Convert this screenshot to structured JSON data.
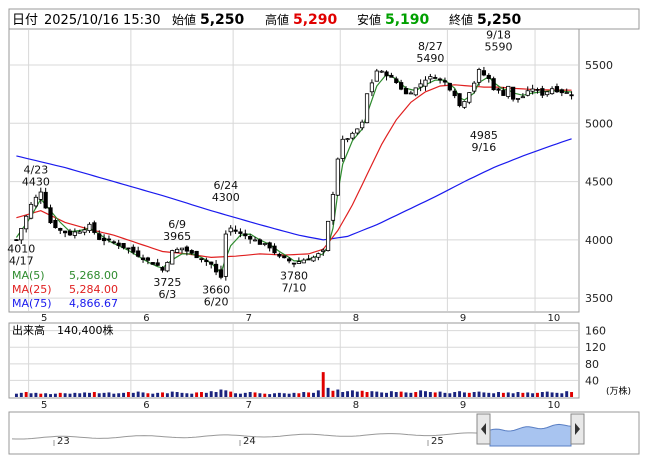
{
  "header": {
    "date_label": "日付",
    "date_value": "2025/10/16 15:30",
    "open_label": "始値",
    "open_value": "5,250",
    "high_label": "高値",
    "high_value": "5,290",
    "low_label": "安値",
    "low_value": "5,190",
    "close_label": "終値",
    "close_value": "5,250"
  },
  "colors": {
    "bull": "#ffffff",
    "bear": "#000000",
    "ma5": "#2e8b2e",
    "ma25": "#e02020",
    "ma75": "#1a1aee",
    "high_text": "#e00000",
    "low_text": "#00a000",
    "volume_bar": "#1a237e",
    "volume_highlight": "#e00000",
    "overview_fill": "#a8c4f0"
  },
  "chart_data": [
    {
      "type": "candlestick",
      "y_ticks": [
        3500,
        4000,
        4500,
        5000,
        5500
      ],
      "ylim": [
        3390,
        5800
      ],
      "x_ticks": [
        "5",
        "6",
        "7",
        "8",
        "9",
        "10"
      ],
      "legend": [
        {
          "name": "MA(5)",
          "value": "5,268.00"
        },
        {
          "name": "MA(25)",
          "value": "5,284.00"
        },
        {
          "name": "MA(75)",
          "value": "4,866.67"
        }
      ],
      "annotations": [
        {
          "label": "4/23",
          "value": "4430"
        },
        {
          "label": "4/17",
          "value": "4010"
        },
        {
          "label": "6/9",
          "value": "3965"
        },
        {
          "label": "6/3",
          "value": "3725"
        },
        {
          "label": "6/24",
          "value": "4300"
        },
        {
          "label": "6/20",
          "value": "3660"
        },
        {
          "label": "7/10",
          "value": "3780"
        },
        {
          "label": "8/27",
          "value": "5490"
        },
        {
          "label": "9/18",
          "value": "5590"
        },
        {
          "label": "9/16",
          "value": "4985"
        }
      ],
      "close_path": [
        [
          0,
          4000
        ],
        [
          3,
          4300
        ],
        [
          5,
          4420
        ],
        [
          7,
          4150
        ],
        [
          9,
          4080
        ],
        [
          11,
          4050
        ],
        [
          13,
          4080
        ],
        [
          15,
          4120
        ],
        [
          17,
          4010
        ],
        [
          19,
          3990
        ],
        [
          21,
          3960
        ],
        [
          23,
          3920
        ],
        [
          25,
          3870
        ],
        [
          27,
          3820
        ],
        [
          29,
          3780
        ],
        [
          30,
          3740
        ],
        [
          32,
          3900
        ],
        [
          34,
          3930
        ],
        [
          36,
          3880
        ],
        [
          38,
          3840
        ],
        [
          40,
          3790
        ],
        [
          41,
          3720
        ],
        [
          42,
          3680
        ],
        [
          43,
          4050
        ],
        [
          44,
          4100
        ],
        [
          46,
          4050
        ],
        [
          48,
          4020
        ],
        [
          50,
          3970
        ],
        [
          52,
          3940
        ],
        [
          54,
          3850
        ],
        [
          56,
          3820
        ],
        [
          57,
          3800
        ],
        [
          59,
          3830
        ],
        [
          61,
          3850
        ],
        [
          63,
          3900
        ],
        [
          64,
          4150
        ],
        [
          65,
          4400
        ],
        [
          66,
          4700
        ],
        [
          67,
          4850
        ],
        [
          69,
          4900
        ],
        [
          71,
          5000
        ],
        [
          72,
          5250
        ],
        [
          73,
          5350
        ],
        [
          74,
          5450
        ],
        [
          76,
          5420
        ],
        [
          78,
          5350
        ],
        [
          80,
          5250
        ],
        [
          82,
          5300
        ],
        [
          84,
          5380
        ],
        [
          86,
          5400
        ],
        [
          88,
          5350
        ],
        [
          90,
          5250
        ],
        [
          91,
          5150
        ],
        [
          92,
          5200
        ],
        [
          94,
          5350
        ],
        [
          95,
          5450
        ],
        [
          97,
          5380
        ],
        [
          98,
          5300
        ],
        [
          100,
          5250
        ],
        [
          101,
          5320
        ],
        [
          102,
          5200
        ],
        [
          104,
          5230
        ],
        [
          106,
          5300
        ],
        [
          108,
          5250
        ],
        [
          110,
          5300
        ],
        [
          112,
          5270
        ],
        [
          114,
          5250
        ]
      ],
      "ma5": [
        [
          0,
          4020
        ],
        [
          3,
          4200
        ],
        [
          5,
          4350
        ],
        [
          7,
          4250
        ],
        [
          9,
          4150
        ],
        [
          11,
          4070
        ],
        [
          13,
          4080
        ],
        [
          15,
          4100
        ],
        [
          17,
          4050
        ],
        [
          19,
          3990
        ],
        [
          21,
          3950
        ],
        [
          23,
          3910
        ],
        [
          25,
          3860
        ],
        [
          27,
          3810
        ],
        [
          29,
          3770
        ],
        [
          30,
          3760
        ],
        [
          32,
          3830
        ],
        [
          34,
          3880
        ],
        [
          36,
          3880
        ],
        [
          38,
          3850
        ],
        [
          40,
          3800
        ],
        [
          41,
          3760
        ],
        [
          42,
          3720
        ],
        [
          43,
          3840
        ],
        [
          44,
          3950
        ],
        [
          46,
          4040
        ],
        [
          48,
          4050
        ],
        [
          50,
          4000
        ],
        [
          52,
          3960
        ],
        [
          54,
          3900
        ],
        [
          56,
          3850
        ],
        [
          57,
          3820
        ],
        [
          59,
          3820
        ],
        [
          61,
          3850
        ],
        [
          63,
          3880
        ],
        [
          64,
          3950
        ],
        [
          65,
          4100
        ],
        [
          66,
          4400
        ],
        [
          67,
          4650
        ],
        [
          69,
          4850
        ],
        [
          71,
          4950
        ],
        [
          72,
          5080
        ],
        [
          73,
          5200
        ],
        [
          74,
          5320
        ],
        [
          76,
          5420
        ],
        [
          78,
          5380
        ],
        [
          80,
          5300
        ],
        [
          82,
          5280
        ],
        [
          84,
          5330
        ],
        [
          86,
          5370
        ],
        [
          88,
          5370
        ],
        [
          90,
          5300
        ],
        [
          91,
          5220
        ],
        [
          92,
          5200
        ],
        [
          94,
          5260
        ],
        [
          95,
          5350
        ],
        [
          97,
          5400
        ],
        [
          98,
          5350
        ],
        [
          100,
          5290
        ],
        [
          101,
          5290
        ],
        [
          102,
          5260
        ],
        [
          104,
          5240
        ],
        [
          106,
          5260
        ],
        [
          108,
          5270
        ],
        [
          110,
          5280
        ],
        [
          112,
          5275
        ],
        [
          114,
          5268
        ]
      ],
      "ma25": [
        [
          0,
          4190
        ],
        [
          5,
          4250
        ],
        [
          10,
          4150
        ],
        [
          15,
          4090
        ],
        [
          20,
          4040
        ],
        [
          25,
          3970
        ],
        [
          30,
          3900
        ],
        [
          35,
          3880
        ],
        [
          40,
          3850
        ],
        [
          45,
          3860
        ],
        [
          50,
          3880
        ],
        [
          55,
          3870
        ],
        [
          60,
          3880
        ],
        [
          63,
          3920
        ],
        [
          66,
          4080
        ],
        [
          69,
          4300
        ],
        [
          72,
          4560
        ],
        [
          75,
          4820
        ],
        [
          78,
          5030
        ],
        [
          81,
          5180
        ],
        [
          84,
          5270
        ],
        [
          87,
          5320
        ],
        [
          90,
          5330
        ],
        [
          93,
          5320
        ],
        [
          96,
          5310
        ],
        [
          99,
          5310
        ],
        [
          102,
          5300
        ],
        [
          106,
          5290
        ],
        [
          110,
          5285
        ],
        [
          114,
          5284
        ]
      ],
      "ma75": [
        [
          0,
          4720
        ],
        [
          10,
          4620
        ],
        [
          20,
          4500
        ],
        [
          30,
          4380
        ],
        [
          40,
          4250
        ],
        [
          50,
          4130
        ],
        [
          58,
          4040
        ],
        [
          63,
          4000
        ],
        [
          68,
          4030
        ],
        [
          74,
          4130
        ],
        [
          80,
          4250
        ],
        [
          86,
          4370
        ],
        [
          92,
          4500
        ],
        [
          98,
          4620
        ],
        [
          104,
          4720
        ],
        [
          110,
          4810
        ],
        [
          114,
          4867
        ]
      ]
    },
    {
      "type": "bar",
      "title": "出来高",
      "label_value": "140,400株",
      "y_ticks": [
        40,
        80,
        120,
        160
      ],
      "ylim": [
        0,
        176
      ],
      "unit": "(万株)",
      "x_ticks": [
        "5",
        "6",
        "7",
        "8",
        "9",
        "10"
      ],
      "volumes": [
        8,
        10,
        12,
        9,
        10,
        8,
        9,
        7,
        8,
        10,
        9,
        8,
        10,
        9,
        11,
        10,
        12,
        9,
        10,
        11,
        8,
        9,
        10,
        12,
        10,
        13,
        11,
        9,
        8,
        10,
        11,
        9,
        13,
        12,
        10,
        9,
        8,
        11,
        12,
        10,
        14,
        12,
        18,
        16,
        13,
        9,
        8,
        10,
        12,
        11,
        9,
        8,
        7,
        9,
        10,
        9,
        8,
        10,
        9,
        12,
        11,
        10,
        16,
        60,
        22,
        15,
        18,
        12,
        14,
        16,
        13,
        15,
        12,
        14,
        13,
        11,
        10,
        14,
        12,
        13,
        11,
        10,
        12,
        16,
        14,
        12,
        11,
        13,
        10,
        9,
        12,
        14,
        11,
        10,
        12,
        13,
        11,
        10,
        9,
        12,
        10,
        11,
        9,
        12,
        10,
        11,
        9,
        10,
        12,
        13,
        11,
        10,
        9,
        14,
        12
      ]
    },
    {
      "type": "area",
      "x_ticks": [
        "23",
        "24",
        "25"
      ]
    }
  ]
}
